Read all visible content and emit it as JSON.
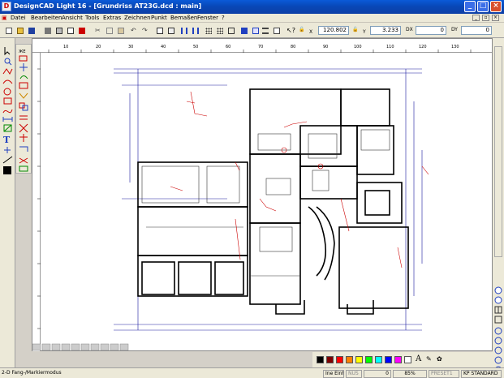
{
  "window": {
    "title": "DesignCAD Light 16 - [Grundriss AT23G.dcd : main]"
  },
  "menu": [
    "Datei",
    "Bearbeiten",
    "Ansicht",
    "Tools",
    "Extras",
    "Zeichnen",
    "Punkt",
    "Bemaßen",
    "Fenster",
    "?"
  ],
  "coords": {
    "x_label": "X",
    "x_value": "120.802",
    "y_label": "Y",
    "y_value": "3.233",
    "dx_label": "DX",
    "dx_value": "0",
    "dy_label": "DY",
    "dy_value": "0"
  },
  "ruler_top": [
    "10",
    "20",
    "30",
    "40",
    "50",
    "60",
    "70",
    "80",
    "90",
    "100",
    "110",
    "120",
    "130"
  ],
  "status": {
    "mode": "2-D Fang-/Markiermodus",
    "snap": "Ine Einh",
    "caps": "NUS",
    "zoom": "85%",
    "preset": "PRESET1",
    "style": "KP STANDARD",
    "value": "0"
  },
  "colors": [
    "#000000",
    "#7f0000",
    "#ff0000",
    "#ff8000",
    "#ffff00",
    "#00ff00",
    "#00ffff",
    "#0000ff",
    "#ff00ff",
    "#ffffff"
  ],
  "tool_labels": {
    "text": "A"
  }
}
